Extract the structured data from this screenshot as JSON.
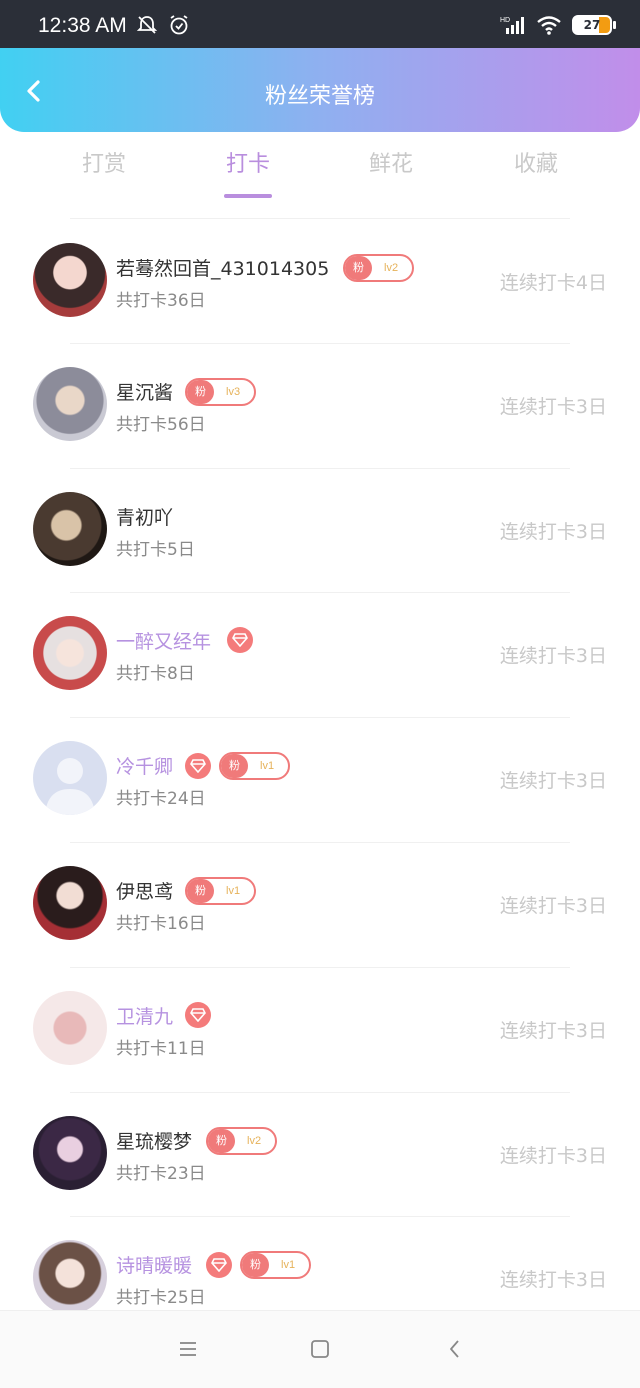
{
  "status_bar": {
    "time": "12:38 AM",
    "battery": "27",
    "network": "HD"
  },
  "header": {
    "title": "粉丝荣誉榜"
  },
  "tabs": [
    {
      "label": "打赏",
      "active": false
    },
    {
      "label": "打卡",
      "active": true
    },
    {
      "label": "鲜花",
      "active": false
    },
    {
      "label": "收藏",
      "active": false
    }
  ],
  "list": [
    {
      "name": "若蓦然回首_431014305",
      "name_color": "normal",
      "gem": false,
      "fan_badge": {
        "label": "粉",
        "level": "lv2"
      },
      "total": "共打卡36日",
      "streak": "连续打卡4日"
    },
    {
      "name": "星沉酱",
      "name_color": "normal",
      "gem": false,
      "fan_badge": {
        "label": "粉",
        "level": "lv3"
      },
      "total": "共打卡56日",
      "streak": "连续打卡3日"
    },
    {
      "name": "青初吖",
      "name_color": "normal",
      "gem": false,
      "fan_badge": null,
      "total": "共打卡5日",
      "streak": "连续打卡3日"
    },
    {
      "name": "一醉又经年",
      "name_color": "purple",
      "gem": true,
      "fan_badge": null,
      "total": "共打卡8日",
      "streak": "连续打卡3日"
    },
    {
      "name": "冷千卿",
      "name_color": "purple",
      "gem": true,
      "fan_badge": {
        "label": "粉",
        "level": "lv1"
      },
      "total": "共打卡24日",
      "streak": "连续打卡3日"
    },
    {
      "name": "伊思鸢",
      "name_color": "normal",
      "gem": false,
      "fan_badge": {
        "label": "粉",
        "level": "lv1"
      },
      "total": "共打卡16日",
      "streak": "连续打卡3日"
    },
    {
      "name": "卫清九",
      "name_color": "purple",
      "gem": true,
      "fan_badge": null,
      "total": "共打卡11日",
      "streak": "连续打卡3日"
    },
    {
      "name": "星琉樱梦",
      "name_color": "normal",
      "gem": false,
      "fan_badge": {
        "label": "粉",
        "level": "lv2"
      },
      "total": "共打卡23日",
      "streak": "连续打卡3日"
    },
    {
      "name": "诗晴暖暖",
      "name_color": "purple",
      "gem": true,
      "fan_badge": {
        "label": "粉",
        "level": "lv1"
      },
      "total": "共打卡25日",
      "streak": "连续打卡3日"
    }
  ],
  "colors": {
    "accent": "#b98ede",
    "badge_red": "#f07a7a",
    "header_start": "#41d0f2",
    "header_end": "#c18eea"
  },
  "icons": {
    "back": "chevron-left-icon",
    "nav_menu": "menu-icon",
    "nav_home": "square-icon",
    "nav_back": "triangle-back-icon"
  }
}
